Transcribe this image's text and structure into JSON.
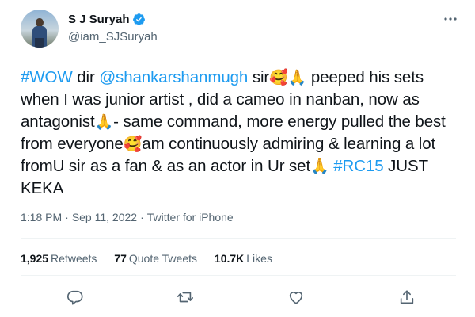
{
  "author": {
    "display_name": "S J Suryah",
    "handle": "@iam_SJSuryah",
    "verified": true
  },
  "tweet": {
    "segments": [
      {
        "text": "#WOW",
        "type": "link"
      },
      {
        "text": " dir ",
        "type": "text"
      },
      {
        "text": "@shankarshanmugh",
        "type": "link"
      },
      {
        "text": " sir",
        "type": "text"
      },
      {
        "text": "🥰🙏",
        "type": "emoji"
      },
      {
        "text": " peeped his sets when I was junior artist , did a cameo in nanban, now as antagonist",
        "type": "text"
      },
      {
        "text": "🙏",
        "type": "emoji"
      },
      {
        "text": "- same command, more energy pulled the best from everyone",
        "type": "text"
      },
      {
        "text": "🥰",
        "type": "emoji"
      },
      {
        "text": "am continuously admiring & learning a lot fromU sir as a fan & as an actor in Ur set",
        "type": "text"
      },
      {
        "text": "🙏",
        "type": "emoji"
      },
      {
        "text": " ",
        "type": "text"
      },
      {
        "text": "#RC15",
        "type": "link"
      },
      {
        "text": " JUST KEKA",
        "type": "text"
      }
    ]
  },
  "meta": {
    "time": "1:18 PM",
    "separator": "·",
    "date": "Sep 11, 2022",
    "source": "Twitter for iPhone"
  },
  "stats": {
    "retweets_count": "1,925",
    "retweets_label": "Retweets",
    "quotes_count": "77",
    "quotes_label": "Quote Tweets",
    "likes_count": "10.7K",
    "likes_label": "Likes"
  },
  "icons": {
    "reply": "reply-icon",
    "retweet": "retweet-icon",
    "like": "heart-icon",
    "share": "share-icon",
    "more": "more-options-icon",
    "verified": "verified-badge-icon"
  },
  "colors": {
    "link": "#1d9bf0",
    "text": "#0f1419",
    "secondary": "#536471",
    "verified": "#1d9bf0"
  }
}
